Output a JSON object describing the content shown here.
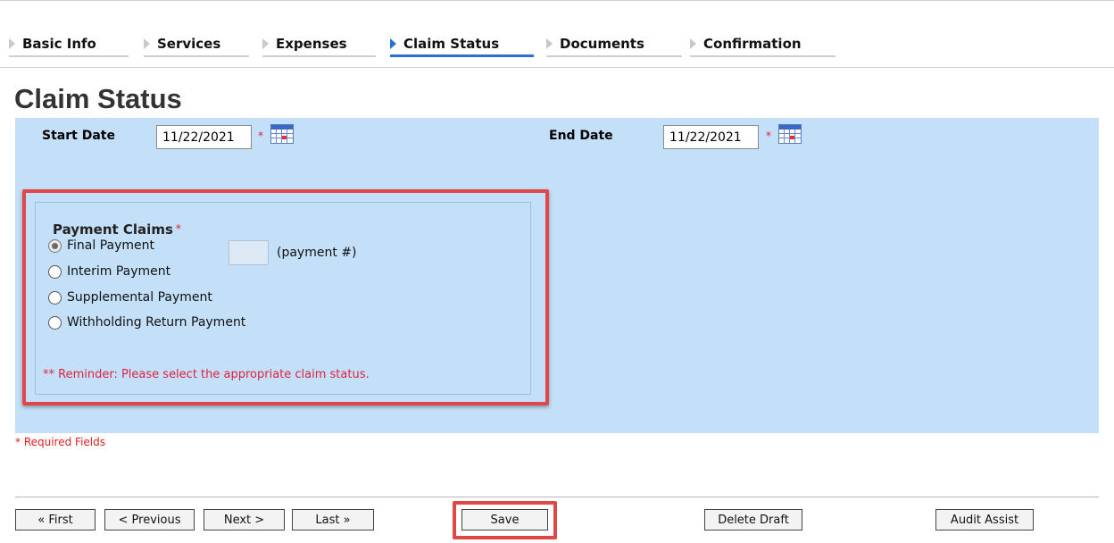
{
  "tabs": [
    {
      "label": "Basic Info",
      "active": false
    },
    {
      "label": "Services",
      "active": false
    },
    {
      "label": "Expenses",
      "active": false
    },
    {
      "label": "Claim Status",
      "active": true
    },
    {
      "label": "Documents",
      "active": false
    },
    {
      "label": "Confirmation",
      "active": false
    }
  ],
  "page_title": "Claim Status",
  "dates": {
    "start_label": "Start Date",
    "start_value": "11/22/2021",
    "end_label": "End Date",
    "end_value": "11/22/2021",
    "required_marker": "*"
  },
  "payment_claims": {
    "title": "Payment Claims",
    "required_marker": "*",
    "options": [
      {
        "label": "Final Payment",
        "selected": true
      },
      {
        "label": "Interim Payment",
        "selected": false
      },
      {
        "label": "Supplemental Payment",
        "selected": false
      },
      {
        "label": "Withholding Return Payment",
        "selected": false
      }
    ],
    "payment_number_label": "(payment #)",
    "payment_number_value": "",
    "reminder": "** Reminder: Please select the appropriate claim status."
  },
  "required_note": "* Required Fields",
  "buttons": {
    "first": "« First",
    "previous": "< Previous",
    "next": "Next >",
    "last": "Last »",
    "save": "Save",
    "delete_draft": "Delete Draft",
    "audit_assist": "Audit Assist"
  },
  "colors": {
    "panel_bg": "#c3e0f8",
    "active_tab_accent": "#2a6fd6",
    "highlight_red": "#e04848",
    "required_red": "#e02020"
  },
  "icons": {
    "tab_marker": "triangle-right-icon",
    "date_picker": "calendar-icon"
  }
}
